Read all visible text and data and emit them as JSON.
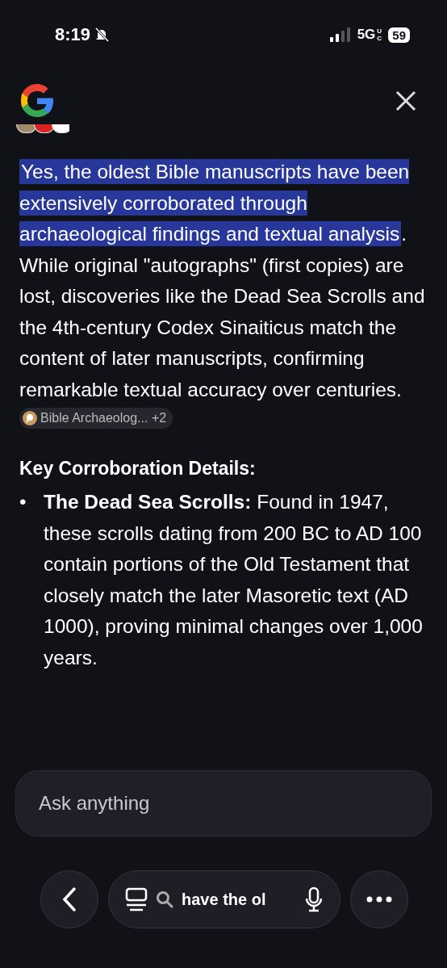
{
  "status_bar": {
    "time": "8:19",
    "silent": true,
    "network": "5G",
    "network_suffix": "UC",
    "battery": "59"
  },
  "answer": {
    "intro": [
      {
        "text": "Yes, the oldest Bible manuscripts have been extensively corroborated through archaeological findings and textual analysis",
        "highlighted": true
      },
      {
        "text": ". While original \"autographs\" (first copies) are lost, discoveries like the Dead Sea Scrolls and the 4th-century Codex Sinaiticus match the content of later manuscripts, confirming remarkable textual accuracy over centuries.",
        "highlighted": false
      }
    ],
    "source_chip": {
      "label": "Bible Archaeolog...",
      "more": "+2"
    },
    "heading": "Key Corroboration Details:",
    "bullets": [
      {
        "marker": "•",
        "title": "The Dead Sea Scrolls:",
        "text": " Found in 1947, these scrolls dating from 200 BC to AD 100 contain portions of the Old Testament that closely match the later Masoretic text (AD 1000), proving minimal changes over 1,000 years."
      }
    ]
  },
  "ask_field": {
    "placeholder": "Ask anything"
  },
  "bottom_bar": {
    "query": "have the ol"
  }
}
